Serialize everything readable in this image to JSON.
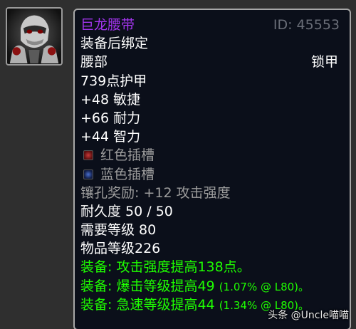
{
  "item": {
    "name": "巨龙腰带",
    "id_label": "ID: 45553",
    "bind": "装备后绑定",
    "slot": "腰部",
    "armor_type": "锁甲",
    "armor": "739点护甲",
    "stats": [
      "+48 敏捷",
      "+66 耐力",
      "+44 智力"
    ],
    "sockets": [
      {
        "label": "红色插槽",
        "color": "#c83a3a",
        "icon": "red-socket-icon"
      },
      {
        "label": "蓝色插槽",
        "color": "#4a6fd0",
        "icon": "blue-socket-icon"
      }
    ],
    "socket_bonus": "镶孔奖励: +12 攻击强度",
    "durability": "耐久度 50 / 50",
    "required_level": "需要等级 80",
    "item_level": "物品等级226",
    "equip_effects": [
      {
        "prefix": "装备:",
        "text": "攻击强度提高138点。",
        "note": ""
      },
      {
        "prefix": "装备:",
        "text": "爆击等级提高49",
        "note": "(1.07% @ L80)。"
      },
      {
        "prefix": "装备:",
        "text": "急速等级提高44",
        "note": "(1.34% @ L80)。"
      }
    ]
  },
  "icon": {
    "name": "item-icon",
    "description": "masked-helm-icon"
  },
  "watermark": "头条 @Uncle喵喵",
  "colors": {
    "epic": "#a335ee",
    "green": "#1eff00",
    "gray": "#9d9d9d",
    "background": "#0b0f1a",
    "border": "#a7a7a7"
  }
}
